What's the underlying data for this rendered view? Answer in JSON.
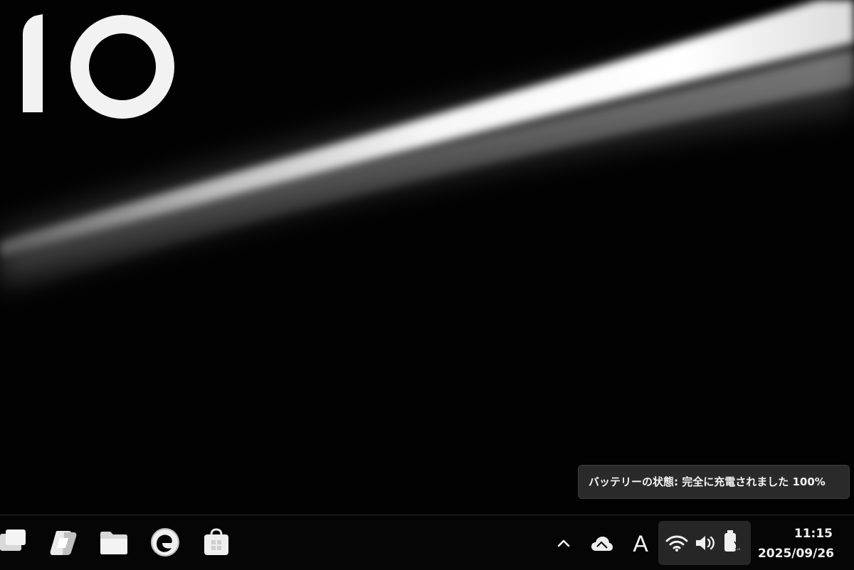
{
  "wallpaper": {
    "logo_text": "10"
  },
  "notification": {
    "battery_status": "バッテリーの状態: 完全に充電されました 100%"
  },
  "taskbar": {
    "pinned_apps": [
      {
        "name": "task-view",
        "icon": "task-view-icon"
      },
      {
        "name": "copilot",
        "icon": "copilot-icon"
      },
      {
        "name": "file-explorer",
        "icon": "folder-icon"
      },
      {
        "name": "edge",
        "icon": "edge-browser-icon"
      },
      {
        "name": "microsoft-store",
        "icon": "store-bag-icon"
      }
    ],
    "tray": {
      "overflow_icon": "chevron-up-icon",
      "onedrive_icon": "cloud-icon",
      "ime_mode": "A",
      "wifi_icon": "wifi-icon",
      "volume_icon": "speaker-icon",
      "battery_icon": "battery-charging-icon"
    },
    "clock": {
      "time": "11:15",
      "date": "2025/09/26"
    }
  },
  "colors": {
    "background": "#020202",
    "taskbar": "#050505",
    "tooltip_bg": "#2a2a2a",
    "quick_settings_bg": "#262626",
    "text": "#f4f4f4"
  }
}
